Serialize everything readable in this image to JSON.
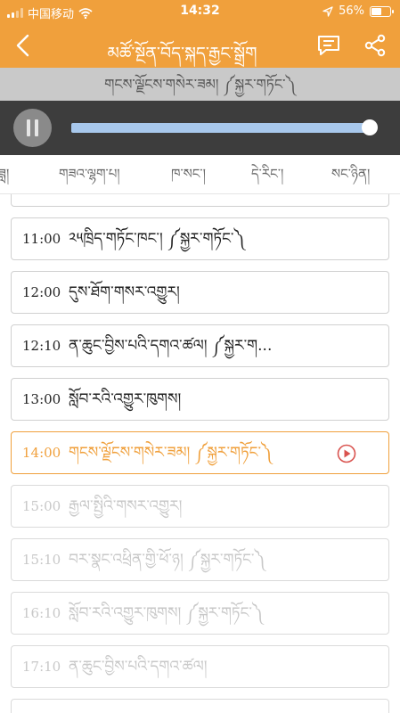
{
  "status_bar": {
    "carrier": "中国移动",
    "time": "14:32",
    "battery_text": "56%",
    "battery_level": 0.56
  },
  "nav": {
    "title": "མཚོ་སྔོན་བོད་སྐད་རྒྱང་སྒྲོག",
    "icons": [
      "back-chevron-icon",
      "comment-icon",
      "share-icon"
    ]
  },
  "now_playing": {
    "program": "གངས་ལྗོངས་གསེར་ཟམ། ༼སྐྱར་གཏོང་༽"
  },
  "player": {
    "progress": 0.99,
    "track_color": "#a8c8ec"
  },
  "tabs": [
    {
      "label": "ཟླ།"
    },
    {
      "label": "གཟའ་ལྷག་པ།"
    },
    {
      "label": "ཁ་སང་།"
    },
    {
      "label": "དེ་རིང་།"
    },
    {
      "label": "སང་ཉིན།"
    }
  ],
  "active_tab": 3,
  "schedule": [
    {
      "time": "",
      "name": "",
      "state": "past"
    },
    {
      "time": "11:00",
      "name": "༢༥ཁྲིད་གཏོང་ཁང་། ༼སྐྱར་གཏོང་༽",
      "state": "past"
    },
    {
      "time": "12:00",
      "name": "དུས་ཐོག་གསར་འགྱུར།",
      "state": "past"
    },
    {
      "time": "12:10",
      "name": "ན་ཆུང་བྱིས་པའི་དགའ་ཚལ། ༼སྐྱར་ག...",
      "state": "past"
    },
    {
      "time": "13:00",
      "name": "སློབ་རའི་འགྱུར་ཁུགས།",
      "state": "past"
    },
    {
      "time": "14:00",
      "name": "གངས་ལྗོངས་གསེར་ཟམ། ༼སྐྱར་གཏོང་༽",
      "state": "current"
    },
    {
      "time": "15:00",
      "name": "རྒྱལ་སྤྱིའི་གསར་འགྱུར།",
      "state": "future"
    },
    {
      "time": "15:10",
      "name": "བར་སྣང་འཕྲིན་གྱི་ཕོ་ཉ། ༼སྐྱར་གཏོང་༽",
      "state": "future"
    },
    {
      "time": "16:10",
      "name": "སློབ་རའི་འགྱུར་ཁུགས། ༼སྐྱར་གཏོང་༽",
      "state": "future"
    },
    {
      "time": "17:10",
      "name": "ན་ཆུང་བྱིས་པའི་དགའ་ཚལ།",
      "state": "future"
    }
  ],
  "colors": {
    "accent": "#f0a03c",
    "player_bg": "#3d3d3d",
    "now_bar_bg": "#c9c9c9"
  }
}
